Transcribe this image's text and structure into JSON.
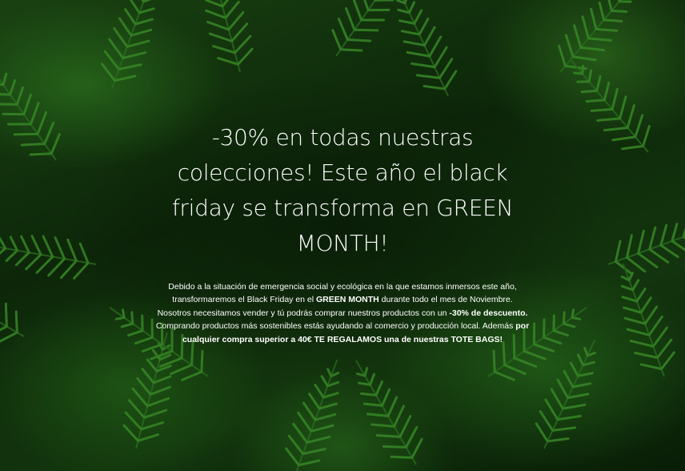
{
  "hero": {
    "headline": "-30% en todas nuestras colecciones! Este año el black friday se transforma en GREEN MONTH!",
    "paragraph": [
      {
        "text": "Debido a la situación de emergencia social y ecológica en la que estamos inmersos este año, transformaremos el Black Friday en el ",
        "bold": false
      },
      {
        "text": "GREEN MONTH",
        "bold": true
      },
      {
        "text": " durante todo el mes de Noviembre. Nosotros necesitamos vender y tú podrás comprar nuestros productos con un ",
        "bold": false
      },
      {
        "text": "-30% de descuento.",
        "bold": true
      },
      {
        "text": " Comprando productos más sostenibles estás ayudando al comercio y producción local.  Además ",
        "bold": false
      },
      {
        "text": "por cualquier compra superior a 40€ TE REGALAMOS una de nuestras TOTE BAGS!",
        "bold": true
      }
    ]
  },
  "colors": {
    "text": "#ffffff",
    "fern_dark": "#0b1f0a",
    "fern_light": "#3f9a2c"
  }
}
